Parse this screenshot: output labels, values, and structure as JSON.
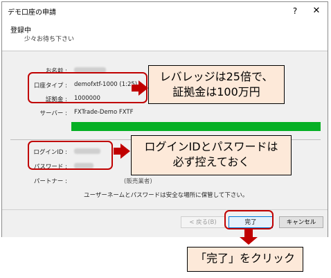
{
  "window": {
    "title": "デモ口座の申請",
    "help": "?",
    "close": "✕"
  },
  "header": {
    "title": "登録中",
    "subtitle": "少々お待ち下さい"
  },
  "fields": {
    "name_label": "お名前 :",
    "account_type_label": "口座タイプ :",
    "account_type_value": "demofxtf-1000 (1:25)",
    "margin_label": "証拠金 :",
    "margin_value": "1000000",
    "server_label": "サーバー :",
    "server_value": "FXTrade-Demo FXTF",
    "login_label": "ログインID :",
    "password_label": "パスワード :",
    "partner_label": "パートナー :",
    "partner_value_hint": "(販売業者)"
  },
  "progress": {
    "value": 1.0,
    "color": "#06b025"
  },
  "notice": "ユーザーネームとパスワードは安全な場所に保管して下さい。",
  "footer": {
    "back_label": "< 戻る(B)",
    "done_label": "完了",
    "cancel_label": "キャンセル"
  },
  "annotations": {
    "callout1_line1": "レバレッジは25倍で、",
    "callout1_line2": "証拠金は100万円",
    "callout2_line1": "ログインIDとパスワードは",
    "callout2_line2": "必ず控えておく",
    "callout3": "「完了」をクリック",
    "highlight_color": "#c00000",
    "callout_fill": "#fde9d9"
  }
}
